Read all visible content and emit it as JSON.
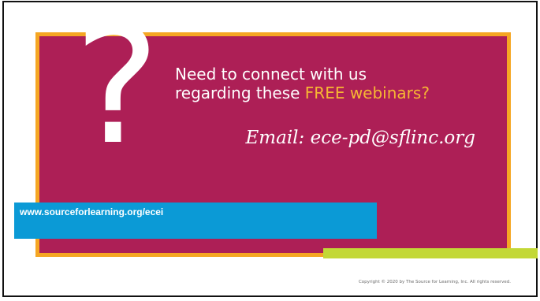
{
  "slide": {
    "question_mark": "?",
    "headline_line1": "Need to connect with us",
    "headline_line2_prefix": "regarding these ",
    "headline_line2_highlight": "FREE webinars?",
    "email": "Email: ece-pd@sflinc.org",
    "url": "www.sourceforlearning.org/ecei",
    "copyright": "Copyright © 2020 by The Source for Learning, Inc. All rights reserved."
  },
  "colors": {
    "panel_bg": "#ad1f56",
    "panel_border": "#f5a623",
    "highlight": "#f7b733",
    "url_bar": "#0b9ad6",
    "accent_bar": "#c3d836"
  }
}
